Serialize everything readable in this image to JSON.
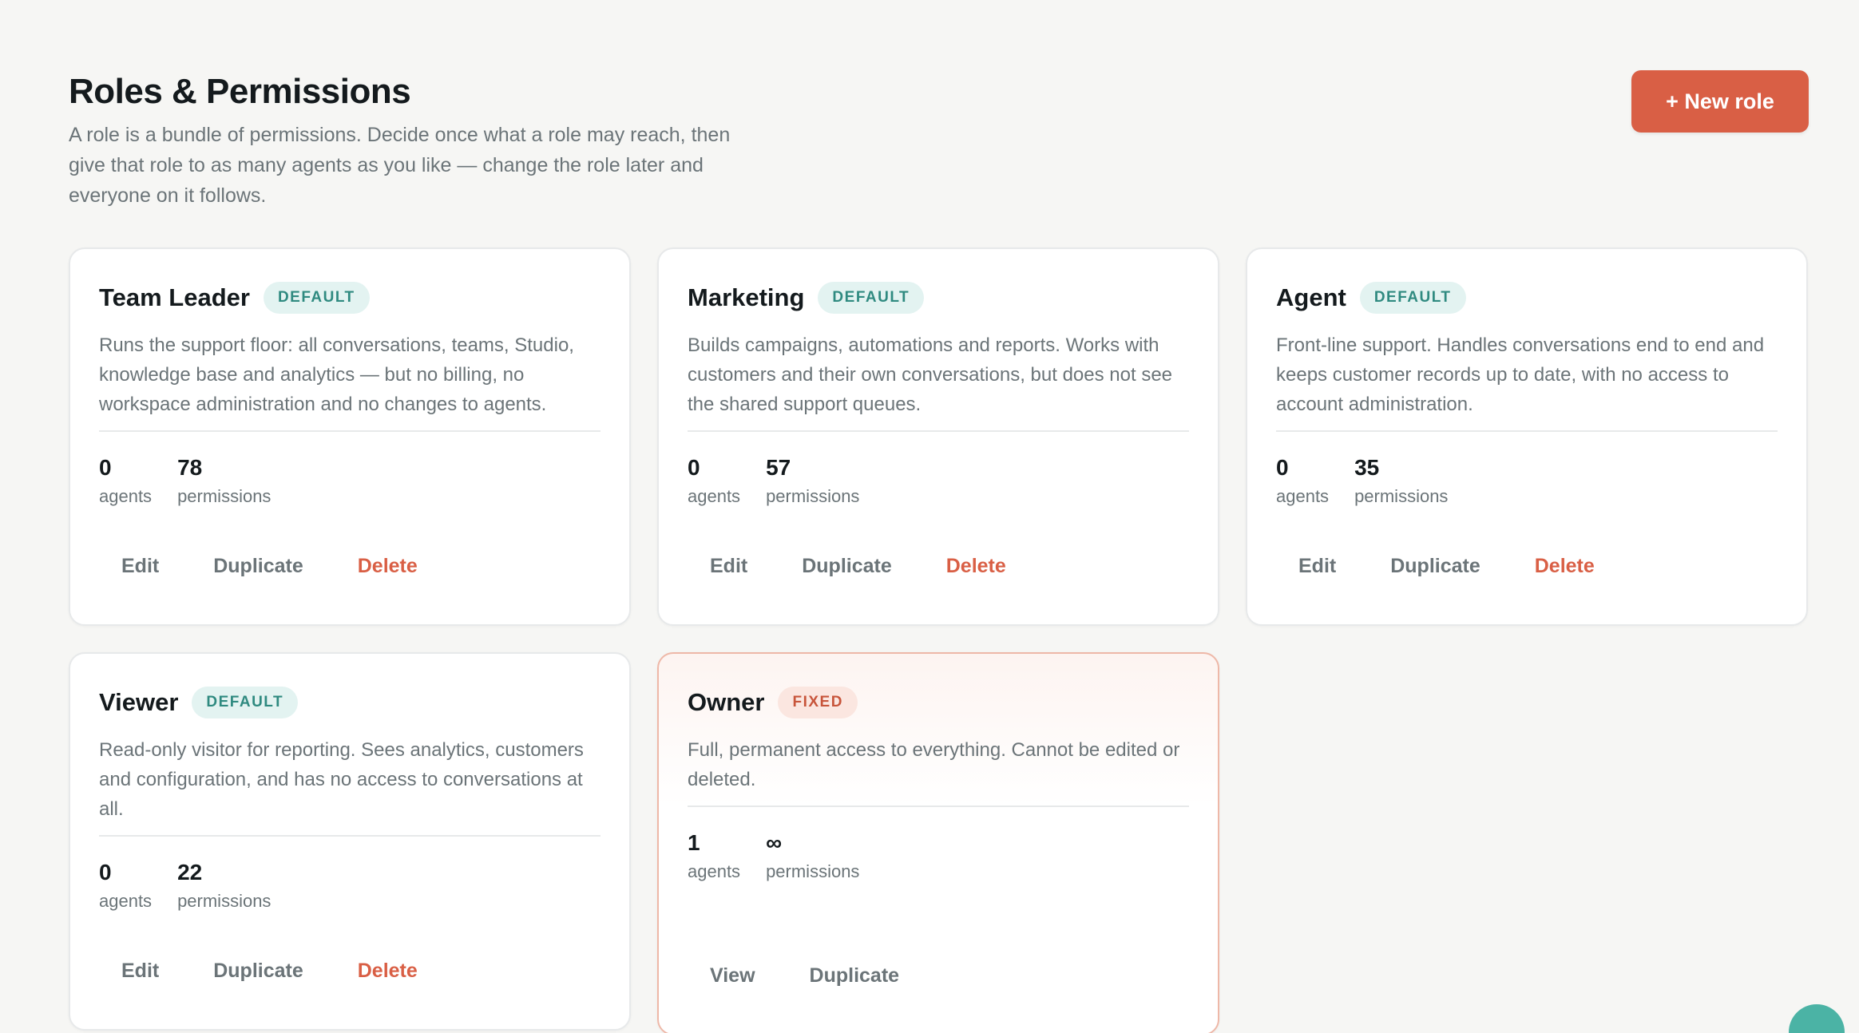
{
  "header": {
    "title": "Roles & Permissions",
    "subtitle": "A role is a bundle of permissions. Decide once what a role may reach, then give that role to as many agents as you like — change the role later and everyone on it follows.",
    "new_role_label": "+ New role"
  },
  "roles": [
    {
      "name": "Team Leader",
      "badge": "DEFAULT",
      "description": "Runs the support floor: all conversations, teams, Studio, knowledge base and analytics — but no billing, no workspace administration and no changes to agents.",
      "agents": "0",
      "permissions": "78",
      "agents_label": "agents",
      "permissions_label": "permissions",
      "actions": [
        "Edit",
        "Duplicate",
        "Delete"
      ]
    },
    {
      "name": "Marketing",
      "badge": "DEFAULT",
      "description": "Builds campaigns, automations and reports. Works with customers and their own conversations, but does not see the shared support queues.",
      "agents": "0",
      "permissions": "57",
      "agents_label": "agents",
      "permissions_label": "permissions",
      "actions": [
        "Edit",
        "Duplicate",
        "Delete"
      ]
    },
    {
      "name": "Agent",
      "badge": "DEFAULT",
      "description": "Front-line support. Handles conversations end to end and keeps customer records up to date, with no access to account administration.",
      "agents": "0",
      "permissions": "35",
      "agents_label": "agents",
      "permissions_label": "permissions",
      "actions": [
        "Edit",
        "Duplicate",
        "Delete"
      ]
    },
    {
      "name": "Viewer",
      "badge": "DEFAULT",
      "description": "Read-only visitor for reporting. Sees analytics, customers and configuration, and has no access to conversations at all.",
      "agents": "0",
      "permissions": "22",
      "agents_label": "agents",
      "permissions_label": "permissions",
      "actions": [
        "Edit",
        "Duplicate",
        "Delete"
      ]
    },
    {
      "name": "Owner",
      "badge": "FIXED",
      "description": "Full, permanent access to everything. Cannot be edited or deleted.",
      "agents": "1",
      "permissions": "∞",
      "agents_label": "agents",
      "permissions_label": "permissions",
      "actions": [
        "View",
        "Duplicate"
      ]
    }
  ],
  "colors": {
    "accent": "#d95f45",
    "default_badge_bg": "#e3f3f1",
    "default_badge_text": "#2f8a80",
    "fixed_badge_bg": "#fbe6e0",
    "fixed_badge_text": "#c8553b"
  }
}
